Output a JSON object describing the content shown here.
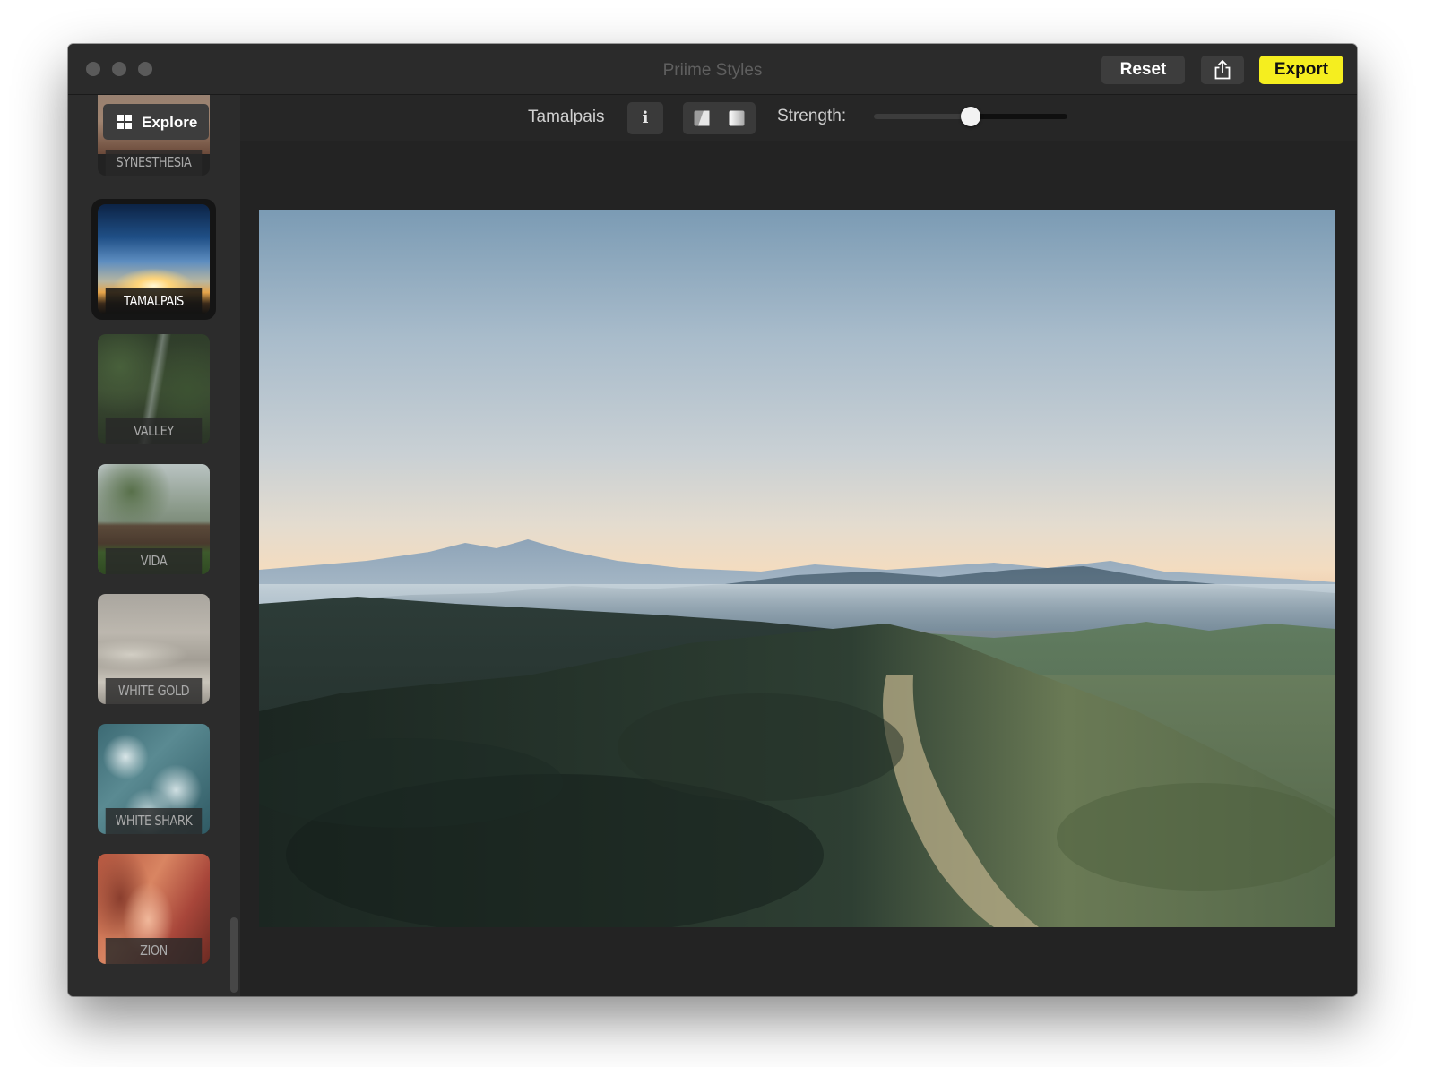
{
  "window": {
    "title": "Priime Styles"
  },
  "titlebar": {
    "reset_label": "Reset",
    "export_label": "Export",
    "share_icon": "share-icon",
    "export_color": "#f5ee1f"
  },
  "toolbar": {
    "explore_label": "Explore",
    "style_name": "Tamalpais",
    "info_label": "i",
    "strength_label": "Strength:",
    "strength_value": 0.5
  },
  "sidebar": {
    "items": [
      {
        "label": "SYNESTHESIA",
        "selected": false
      },
      {
        "label": "TAMALPAIS",
        "selected": true
      },
      {
        "label": "VALLEY",
        "selected": false
      },
      {
        "label": "VIDA",
        "selected": false
      },
      {
        "label": "WHITE GOLD",
        "selected": false
      },
      {
        "label": "WHITE SHARK",
        "selected": false
      },
      {
        "label": "ZION",
        "selected": false
      }
    ]
  }
}
